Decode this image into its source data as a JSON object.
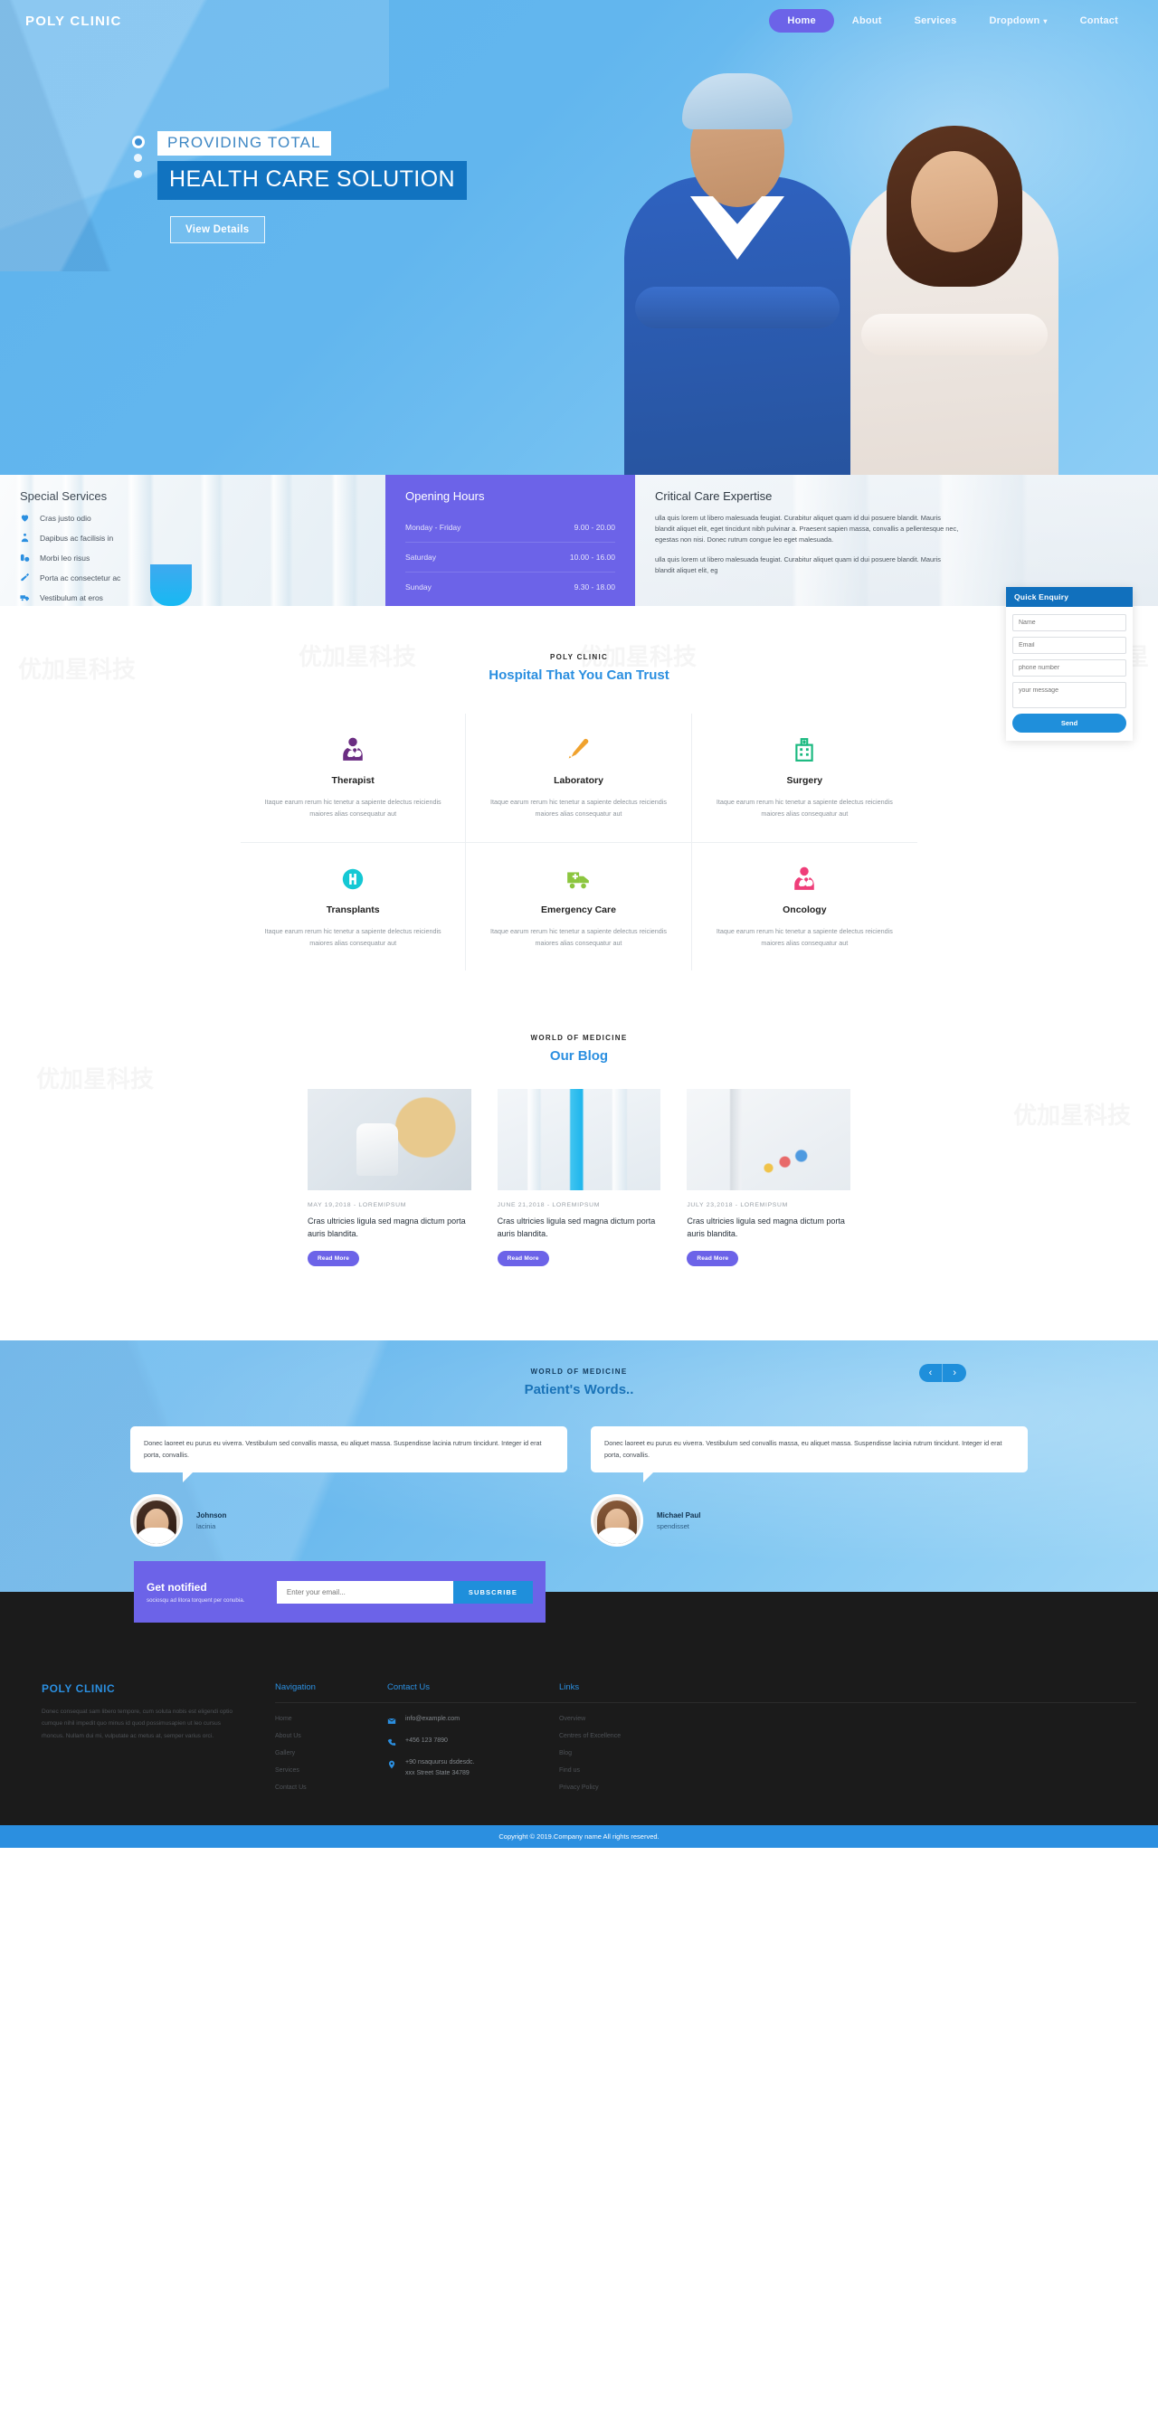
{
  "nav": {
    "brand": "POLY CLINIC",
    "items": [
      {
        "label": "Home",
        "active": true
      },
      {
        "label": "About",
        "active": false
      },
      {
        "label": "Services",
        "active": false
      },
      {
        "label": "Dropdown",
        "active": false,
        "caret": "▾"
      },
      {
        "label": "Contact",
        "active": false
      }
    ]
  },
  "hero": {
    "kicker": "PROVIDING TOTAL",
    "title": "HEALTH CARE SOLUTION",
    "button": "View Details",
    "dots": 3,
    "active_dot": 0
  },
  "special_services": {
    "heading": "Special Services",
    "items": [
      {
        "label": "Cras justo odio",
        "icon": "heartbeat-icon"
      },
      {
        "label": "Dapibus ac facilisis in",
        "icon": "doctor-group-icon"
      },
      {
        "label": "Morbi leo risus",
        "icon": "pills-icon"
      },
      {
        "label": "Porta ac consectetur ac",
        "icon": "syringe-icon"
      },
      {
        "label": "Vestibulum at eros",
        "icon": "ambulance-icon"
      }
    ]
  },
  "opening_hours": {
    "heading": "Opening Hours",
    "rows": [
      {
        "day": "Monday - Friday",
        "time": "9.00 - 20.00"
      },
      {
        "day": "Saturday",
        "time": "10.00 - 16.00"
      },
      {
        "day": "Sunday",
        "time": "9.30 - 18.00"
      }
    ]
  },
  "critical_care": {
    "heading": "Critical Care Expertise",
    "p1": "ulla quis lorem ut libero malesuada feugiat. Curabitur aliquet quam id dui posuere blandit. Mauris blandit aliquet elit, eget tincidunt nibh pulvinar a. Praesent sapien massa, convallis a pellentesque nec, egestas non nisi. Donec rutrum congue leo eget malesuada.",
    "p2": "ulla quis lorem ut libero malesuada feugiat. Curabitur aliquet quam id dui posuere blandit. Mauris blandit aliquet elit, eg"
  },
  "enquiry": {
    "heading": "Quick Enquiry",
    "name_placeholder": "Name",
    "email_placeholder": "Email",
    "phone_placeholder": "phone number",
    "message_placeholder": "your message",
    "send_label": "Send"
  },
  "services_section": {
    "kicker": "POLY CLINIC",
    "title": "Hospital That You Can Trust",
    "body": "Itaque earum rerum hic tenetur a sapiente delectus reiciendis maiores alias consequatur aut",
    "cards": [
      {
        "name": "Therapist",
        "icon": "doctor-icon",
        "color": "#6b2d82"
      },
      {
        "name": "Laboratory",
        "icon": "thermometer-icon",
        "color": "#f0a22e"
      },
      {
        "name": "Surgery",
        "icon": "hospital-building-icon",
        "color": "#19b97f"
      },
      {
        "name": "Transplants",
        "icon": "hospital-h-circle-icon",
        "color": "#14c8d4"
      },
      {
        "name": "Emergency Care",
        "icon": "ambulance-icon",
        "color": "#8cc63f"
      },
      {
        "name": "Oncology",
        "icon": "doctor-icon",
        "color": "#ef3e79"
      }
    ]
  },
  "blog_section": {
    "kicker": "WORLD OF MEDICINE",
    "title": "Our Blog",
    "posts": [
      {
        "meta": "MAY  19,2018  -  LOREMIPSUM",
        "title": "Cras ultricies ligula sed magna dictum porta auris blandita.",
        "button": "Read More"
      },
      {
        "meta": "JUNE  21,2018  -  LOREMIPSUM",
        "title": "Cras ultricies ligula sed magna dictum porta auris blandita.",
        "button": "Read More"
      },
      {
        "meta": "JULY  23,2018  -  LOREMIPSUM",
        "title": "Cras ultricies ligula sed magna dictum porta auris blandita.",
        "button": "Read More"
      }
    ]
  },
  "testimonials": {
    "kicker": "WORLD OF MEDICINE",
    "title": "Patient's Words..",
    "prev": "‹",
    "next": "›",
    "items": [
      {
        "quote": "Donec laoreet eu purus eu viverra. Vestibulum sed convallis massa, eu aliquet massa. Suspendisse lacinia rutrum tincidunt. Integer id erat porta, convallis.",
        "name": "Johnson",
        "role": "lacinia"
      },
      {
        "quote": "Donec laoreet eu purus eu viverra. Vestibulum sed convallis massa, eu aliquet massa. Suspendisse lacinia rutrum tincidunt. Integer id erat porta, convallis.",
        "name": "Michael Paul",
        "role": "spendisset"
      }
    ]
  },
  "newsletter": {
    "heading": "Get notified",
    "sub": "sociosqu ad litora torquent per conubia.",
    "placeholder": "Enter your email...",
    "button": "SUBSCRIBE"
  },
  "footer": {
    "brand": "POLY CLINIC",
    "about": "Donec consequat sam libero tempore, cum soluta nobis est eligendi optio cumque nihil impedit quo minus id quod possimusapien ut leo cursus rhoncus. Nullam dui mi, vulputate ac metus at, semper varius orci.",
    "nav_heading": "Navigation",
    "nav_links": [
      "Home",
      "About Us",
      "Gallery",
      "Services",
      "Contact Us"
    ],
    "contact_heading": "Contact Us",
    "contact": [
      {
        "icon": "envelope-icon",
        "line1": "info@example.com",
        "line2": ""
      },
      {
        "icon": "phone-icon",
        "line1": "+456 123 7890",
        "line2": ""
      },
      {
        "icon": "map-marker-icon",
        "line1": "+90 nsaquursu dsdesdc.",
        "line2": "xxx Street State 34789"
      }
    ],
    "links_heading": "Links",
    "links": [
      "Overview",
      "Centres of Excellence",
      "Blog",
      "Find us",
      "Privacy Policy"
    ],
    "copyright": "Copyright © 2019.Company name All rights reserved."
  }
}
